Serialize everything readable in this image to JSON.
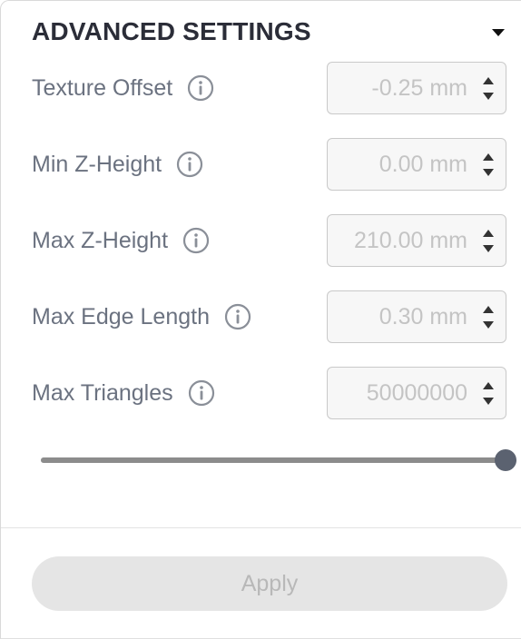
{
  "header": {
    "title": "ADVANCED SETTINGS",
    "toggle_icon": "chevron-down-icon"
  },
  "settings": [
    {
      "label": "Texture Offset",
      "value": "-0.25 mm",
      "info_icon": "info-icon"
    },
    {
      "label": "Min Z-Height",
      "value": "0.00 mm",
      "info_icon": "info-icon"
    },
    {
      "label": "Max Z-Height",
      "value": "210.00 mm",
      "info_icon": "info-icon"
    },
    {
      "label": "Max Edge Length",
      "value": "0.30 mm",
      "info_icon": "info-icon"
    },
    {
      "label": "Max Triangles",
      "value": "50000000",
      "info_icon": "info-icon"
    }
  ],
  "slider": {
    "level_fraction": 1.0
  },
  "footer": {
    "apply_label": "Apply"
  },
  "colors": {
    "heading_text": "#2b2d38",
    "label_text": "#6b7280",
    "disabled_value_text": "#c4c4c4",
    "slider_thumb": "#5b6270",
    "slider_fill": "#8c8c8c",
    "button_disabled_bg": "#e5e5e5",
    "button_disabled_text": "#b8b8b8"
  }
}
